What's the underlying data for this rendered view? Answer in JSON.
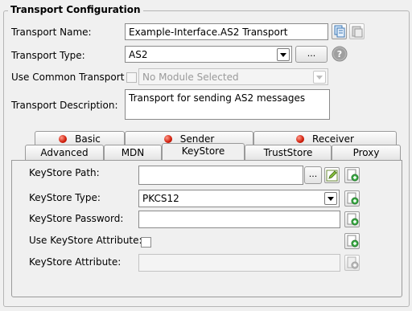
{
  "group": {
    "title": "Transport Configuration"
  },
  "form": {
    "name_label": "Transport Name:",
    "name_value": "Example-Interface.AS2 Transport",
    "type_label": "Transport Type:",
    "type_value": "AS2",
    "type_button": "...",
    "common_label": "Use Common Transport",
    "common_value": "No Module Selected",
    "desc_label": "Transport Description:",
    "desc_value": "Transport for sending AS2 messages"
  },
  "tabs": {
    "row_back": [
      {
        "label": "Basic",
        "error": true
      },
      {
        "label": "Sender",
        "error": true
      },
      {
        "label": "Receiver",
        "error": true
      }
    ],
    "row_front": [
      {
        "label": "Advanced"
      },
      {
        "label": "MDN"
      },
      {
        "label": "KeyStore",
        "active": true
      },
      {
        "label": "TrustStore"
      },
      {
        "label": "Proxy"
      }
    ]
  },
  "keystore": {
    "path_label": "KeyStore Path:",
    "path_value": "",
    "browse_button": "...",
    "type_label": "KeyStore Type:",
    "type_value": "PKCS12",
    "password_label": "KeyStore Password:",
    "password_value": "",
    "use_attr_label": "Use KeyStore Attribute:",
    "attr_label": "KeyStore Attribute:",
    "attr_value": ""
  },
  "colors": {
    "error_dot": "#d01d0a",
    "field_border": "#8a8a8a",
    "background": "#f0f0f0"
  },
  "icons": [
    "copy-icon",
    "paste-icon",
    "help-icon",
    "edit-icon",
    "add-variable-icon"
  ]
}
